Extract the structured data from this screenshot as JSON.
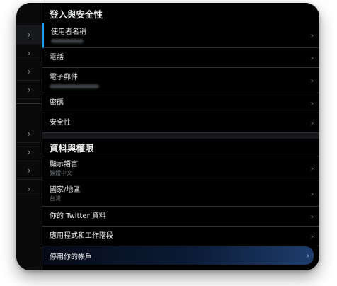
{
  "login_section": {
    "title": "登入與安全性",
    "items": [
      {
        "label": "使用者名稱"
      },
      {
        "label": "電話"
      },
      {
        "label": "電子郵件"
      },
      {
        "label": "密碼"
      },
      {
        "label": "安全性"
      }
    ]
  },
  "data_section": {
    "title": "資料與權限",
    "items": [
      {
        "label": "顯示語言",
        "sub": "繁體中文"
      },
      {
        "label": "國家/地區",
        "sub": "台灣"
      },
      {
        "label": "你的 Twitter 資料"
      },
      {
        "label": "應用程式和工作階段"
      }
    ]
  },
  "deactivate": {
    "label": "停用你的帳戶"
  },
  "icons": {
    "chevron": "chevron-right-icon"
  },
  "colors": {
    "accent": "#1d9bf0",
    "background": "#000000",
    "text": "#e7e9ea",
    "muted": "#71767b"
  }
}
